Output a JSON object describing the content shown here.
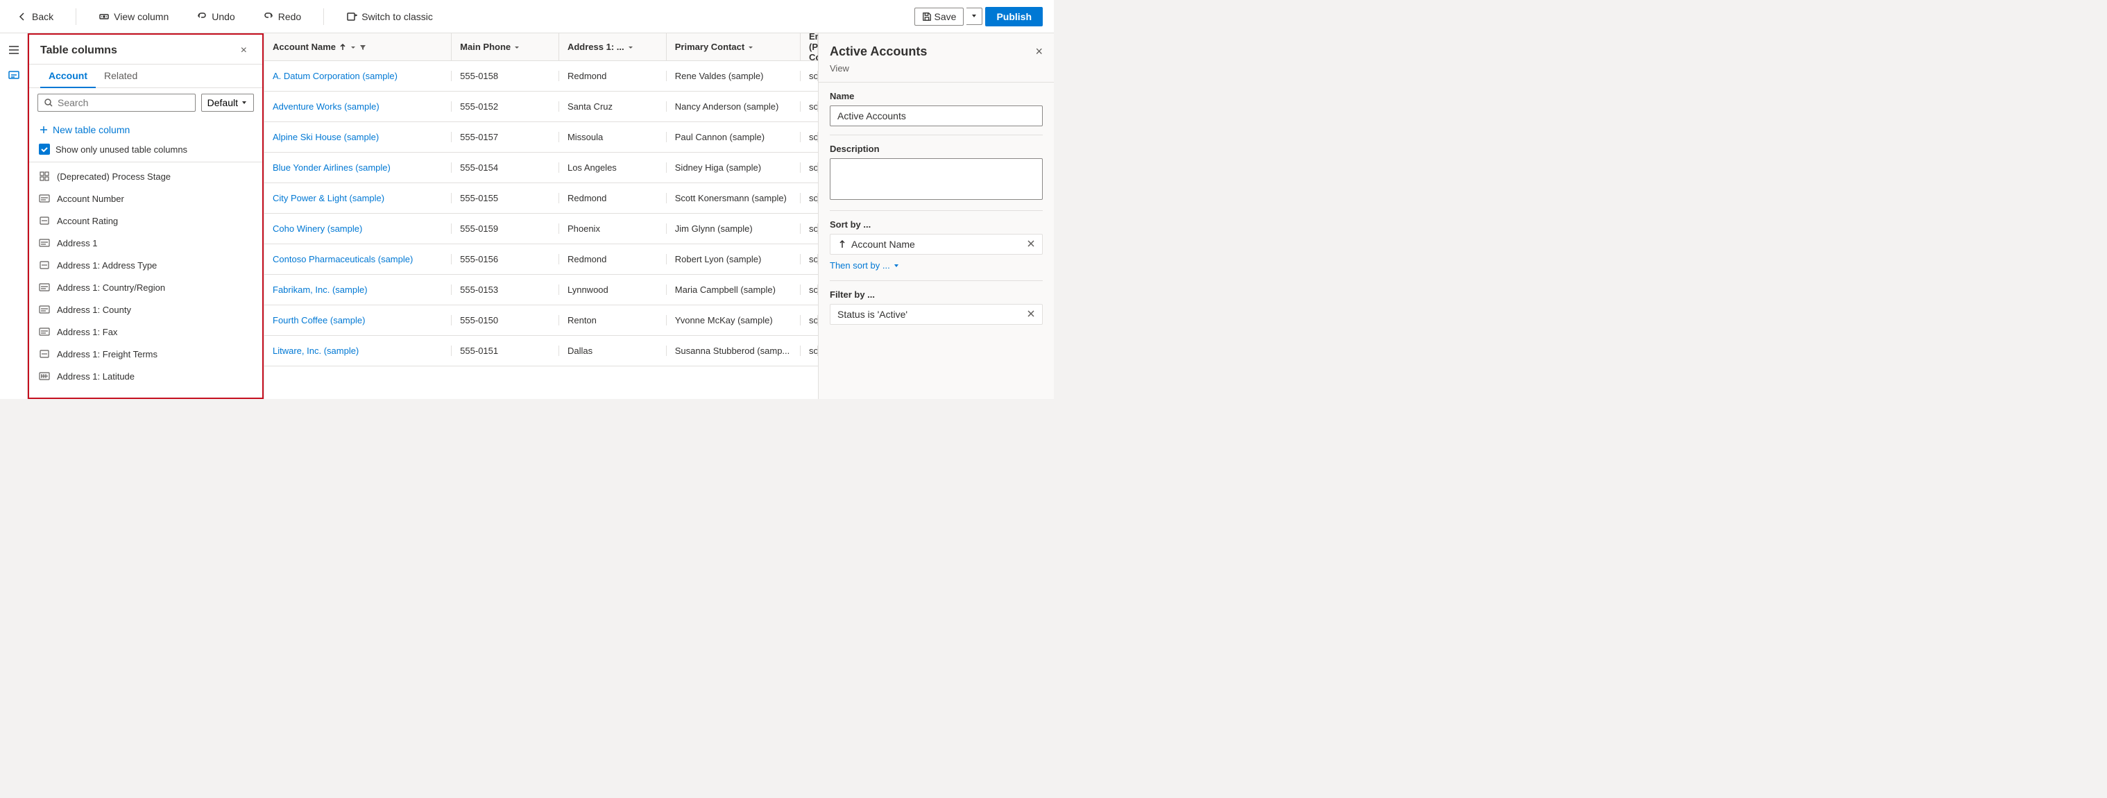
{
  "toolbar": {
    "back_label": "Back",
    "view_column_label": "View column",
    "undo_label": "Undo",
    "redo_label": "Redo",
    "switch_label": "Switch to classic",
    "save_label": "Save",
    "publish_label": "Publish"
  },
  "columns_panel": {
    "title": "Table columns",
    "close_label": "×",
    "tabs": [
      {
        "label": "Account",
        "active": true
      },
      {
        "label": "Related",
        "active": false
      }
    ],
    "search_placeholder": "Search",
    "default_label": "Default",
    "new_col_label": "New table column",
    "unused_label": "Show only unused table columns",
    "columns": [
      {
        "label": "(Deprecated) Process Stage",
        "icon": "grid"
      },
      {
        "label": "Account Number",
        "icon": "abc"
      },
      {
        "label": "Account Rating",
        "icon": "dash"
      },
      {
        "label": "Address 1",
        "icon": "abc"
      },
      {
        "label": "Address 1: Address Type",
        "icon": "dash"
      },
      {
        "label": "Address 1: Country/Region",
        "icon": "abc"
      },
      {
        "label": "Address 1: County",
        "icon": "abc"
      },
      {
        "label": "Address 1: Fax",
        "icon": "abc"
      },
      {
        "label": "Address 1: Freight Terms",
        "icon": "dash"
      },
      {
        "label": "Address 1: Latitude",
        "icon": "num"
      }
    ]
  },
  "grid": {
    "headers": [
      {
        "label": "Account Name",
        "has_sort": true,
        "has_filter": true
      },
      {
        "label": "Main Phone",
        "has_sort": false,
        "has_filter": true
      },
      {
        "label": "Address 1: ...",
        "has_sort": false,
        "has_filter": true
      },
      {
        "label": "Primary Contact",
        "has_sort": false,
        "has_filter": true
      },
      {
        "label": "Email (Primary Co...",
        "has_sort": false,
        "has_filter": true
      }
    ],
    "rows": [
      {
        "account": "A. Datum Corporation (sample)",
        "phone": "555-0158",
        "address": "Redmond",
        "contact": "Rene Valdes (sample)",
        "email": "someone_i@example.com"
      },
      {
        "account": "Adventure Works (sample)",
        "phone": "555-0152",
        "address": "Santa Cruz",
        "contact": "Nancy Anderson (sample)",
        "email": "someone_c@example.com"
      },
      {
        "account": "Alpine Ski House (sample)",
        "phone": "555-0157",
        "address": "Missoula",
        "contact": "Paul Cannon (sample)",
        "email": "someone_h@example.com"
      },
      {
        "account": "Blue Yonder Airlines (sample)",
        "phone": "555-0154",
        "address": "Los Angeles",
        "contact": "Sidney Higa (sample)",
        "email": "someone_e@example.com"
      },
      {
        "account": "City Power & Light (sample)",
        "phone": "555-0155",
        "address": "Redmond",
        "contact": "Scott Konersmann (sample)",
        "email": "someone_f@example.com"
      },
      {
        "account": "Coho Winery (sample)",
        "phone": "555-0159",
        "address": "Phoenix",
        "contact": "Jim Glynn (sample)",
        "email": "someone_j@example.com"
      },
      {
        "account": "Contoso Pharmaceuticals (sample)",
        "phone": "555-0156",
        "address": "Redmond",
        "contact": "Robert Lyon (sample)",
        "email": "someone_g@example.com"
      },
      {
        "account": "Fabrikam, Inc. (sample)",
        "phone": "555-0153",
        "address": "Lynnwood",
        "contact": "Maria Campbell (sample)",
        "email": "someone_d@example.com"
      },
      {
        "account": "Fourth Coffee (sample)",
        "phone": "555-0150",
        "address": "Renton",
        "contact": "Yvonne McKay (sample)",
        "email": "someone_a@example.com"
      },
      {
        "account": "Litware, Inc. (sample)",
        "phone": "555-0151",
        "address": "Dallas",
        "contact": "Susanna Stubberod (samp...",
        "email": "someone_b@example.com"
      }
    ]
  },
  "right_panel": {
    "title": "Active Accounts",
    "close_label": "×",
    "view_label": "View",
    "name_label": "Name",
    "name_value": "Active Accounts",
    "description_label": "Description",
    "description_placeholder": "",
    "sort_label": "Sort by ...",
    "sort_value": "Account Name",
    "then_sort_label": "Then sort by ...",
    "filter_label": "Filter by ...",
    "filter_value": "Status is 'Active'"
  }
}
